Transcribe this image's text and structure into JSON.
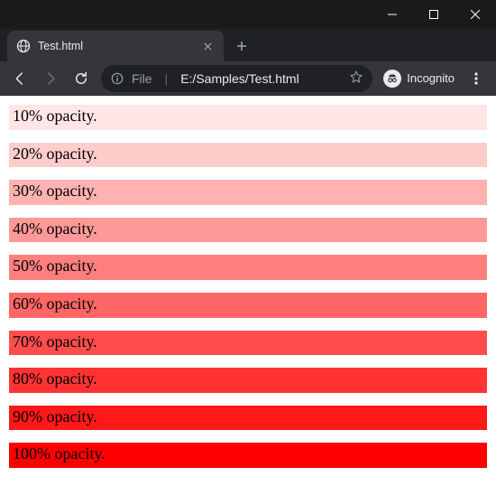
{
  "window": {
    "minimize_tip": "Minimize",
    "maximize_tip": "Maximize",
    "close_tip": "Close"
  },
  "tab": {
    "title": "Test.html",
    "close_tip": "Close tab",
    "newtab_tip": "New tab"
  },
  "toolbar": {
    "back_tip": "Back",
    "forward_tip": "Forward",
    "reload_tip": "Reload",
    "info_tip": "View site information",
    "scheme_label": "File",
    "path_text": "E:/Samples/Test.html",
    "star_tip": "Bookmark this tab",
    "incognito_label": "Incognito",
    "menu_tip": "Customize and control"
  },
  "content": {
    "base_color": "#ff0000",
    "rows": [
      {
        "label": "10% opacity.",
        "opacity": 0.1
      },
      {
        "label": "20% opacity.",
        "opacity": 0.2
      },
      {
        "label": "30% opacity.",
        "opacity": 0.3
      },
      {
        "label": "40% opacity.",
        "opacity": 0.4
      },
      {
        "label": "50% opacity.",
        "opacity": 0.5
      },
      {
        "label": "60% opacity.",
        "opacity": 0.6
      },
      {
        "label": "70% opacity.",
        "opacity": 0.7
      },
      {
        "label": "80% opacity.",
        "opacity": 0.8
      },
      {
        "label": "90% opacity.",
        "opacity": 0.9
      },
      {
        "label": "100% opacity.",
        "opacity": 1.0
      }
    ]
  }
}
